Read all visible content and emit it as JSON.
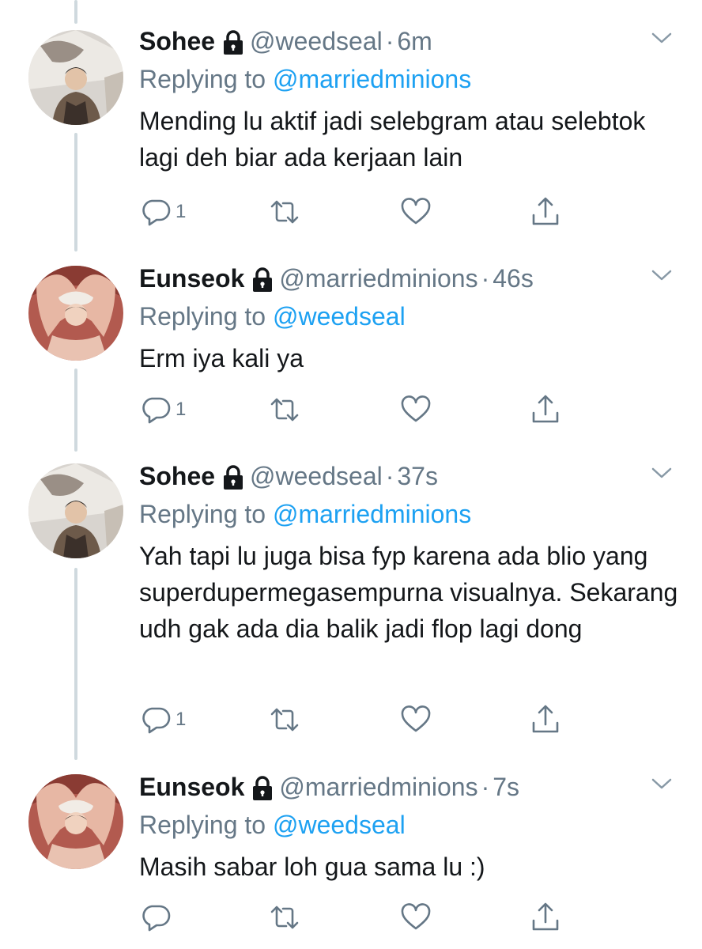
{
  "tweets": [
    {
      "name": "Sohee",
      "handle": "@weedseal",
      "time": "6m",
      "reply_label": "Replying to",
      "reply_to": "@marriedminions",
      "text": "Mending lu aktif jadi selebgram atau selebtok lagi deh biar ada kerjaan lain",
      "reply_count": "1"
    },
    {
      "name": "Eunseok",
      "handle": "@marriedminions",
      "time": "46s",
      "reply_label": "Replying to",
      "reply_to": "@weedseal",
      "text": "Erm iya kali ya",
      "reply_count": "1"
    },
    {
      "name": "Sohee",
      "handle": "@weedseal",
      "time": "37s",
      "reply_label": "Replying to",
      "reply_to": "@marriedminions",
      "text": "Yah tapi lu juga bisa fyp karena ada blio yang superdupermegasempurna visualnya. Sekarang udh gak ada dia balik jadi flop lagi dong",
      "reply_count": "1"
    },
    {
      "name": "Eunseok",
      "handle": "@marriedminions",
      "time": "7s",
      "reply_label": "Replying to",
      "reply_to": "@weedseal",
      "text": "Masih sabar loh gua sama lu :)",
      "reply_count": ""
    }
  ],
  "separator": "·",
  "colors": {
    "accent": "#1da1f2",
    "secondary_text": "#657786",
    "thread_line": "#cfd9de"
  },
  "icons": {
    "lock": "lock-icon",
    "menu": "chevron-down-icon",
    "reply": "reply-icon",
    "retweet": "retweet-icon",
    "like": "heart-icon",
    "share": "share-icon"
  }
}
